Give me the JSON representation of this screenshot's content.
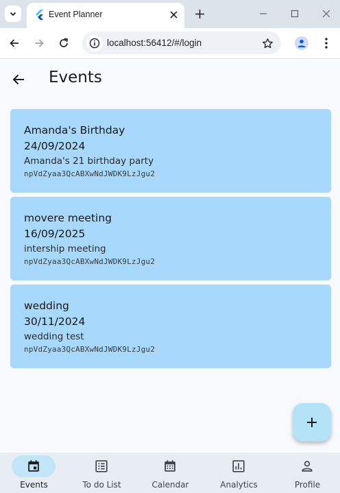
{
  "browser": {
    "tab_title": "Event Planner",
    "url": "localhost:56412/#/login"
  },
  "appbar": {
    "title": "Events"
  },
  "events": [
    {
      "name": "Amanda's Birthday",
      "date": "24/09/2024",
      "description": "Amanda's 21 birthday party",
      "uid": "npVdZyaa3QcABXwNdJWDK9LzJgu2"
    },
    {
      "name": "movere meeting",
      "date": "16/09/2025",
      "description": "intership meeting",
      "uid": "npVdZyaa3QcABXwNdJWDK9LzJgu2"
    },
    {
      "name": "wedding",
      "date": "30/11/2024",
      "description": "wedding test",
      "uid": "npVdZyaa3QcABXwNdJWDK9LzJgu2"
    }
  ],
  "bottom_nav": {
    "active": "Events",
    "items": [
      {
        "label": "Events",
        "icon": "event-icon"
      },
      {
        "label": "To do List",
        "icon": "list-icon"
      },
      {
        "label": "Calendar",
        "icon": "calendar-icon"
      },
      {
        "label": "Analytics",
        "icon": "analytics-icon"
      },
      {
        "label": "Profile",
        "icon": "person-icon"
      }
    ]
  },
  "colors": {
    "card": "#a8d8fb",
    "fab": "#b4e2f6",
    "nav_active_pill": "#c2e6f7",
    "app_background": "#f7f9fd"
  }
}
